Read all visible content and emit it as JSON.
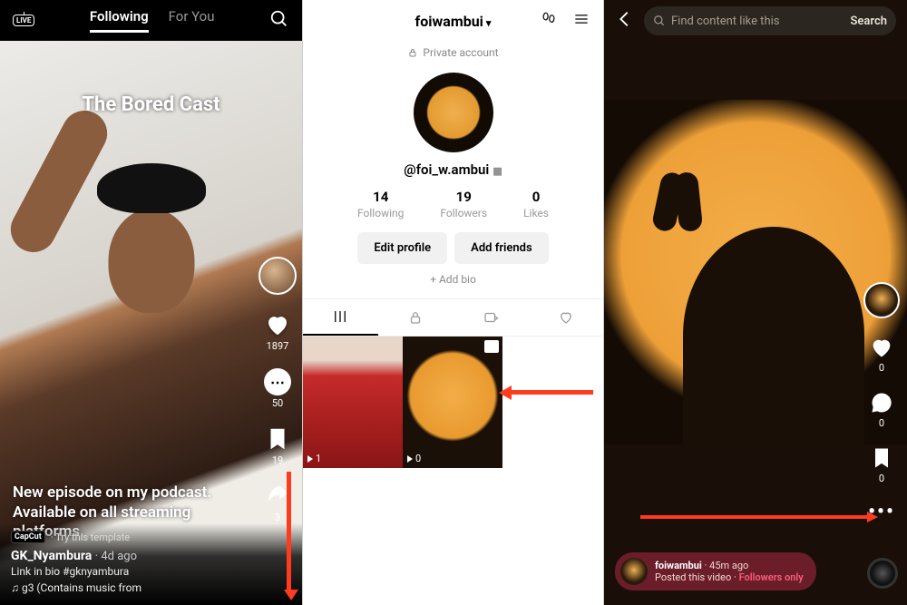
{
  "panel1": {
    "tabs": {
      "following": "Following",
      "foryou": "For You"
    },
    "cast_title": "The Bored Cast",
    "overlay_text": "New episode on my podcast. Available on all streaming platforms.",
    "capcut_badge": "CapCut",
    "template_label": "· Try this template",
    "author": "GK_Nyambura",
    "ago": "· 4d ago",
    "description": "Link in bio #gknyambura",
    "music": "♫ g3 (Contains music from",
    "counts": {
      "likes": "1897",
      "comments": "50",
      "saves": "19",
      "shares": "3"
    }
  },
  "panel2": {
    "username": "foiwambui",
    "private_label": "Private account",
    "handle": "@foi_w.ambui",
    "stats": {
      "following": {
        "num": "14",
        "label": "Following"
      },
      "followers": {
        "num": "19",
        "label": "Followers"
      },
      "likes": {
        "num": "0",
        "label": "Likes"
      }
    },
    "buttons": {
      "edit": "Edit profile",
      "add": "Add friends"
    },
    "add_bio": "+ Add bio",
    "thumbs": {
      "v1": "1",
      "v2": "0"
    }
  },
  "panel3": {
    "search_placeholder": "Find content like this",
    "search_button": "Search",
    "rail": {
      "likes": "0",
      "comments": "0",
      "saves": "0"
    },
    "noti": {
      "user": "foiwambui",
      "ago": "· 45m ago",
      "line": "Posted this video · ",
      "followers_only": "Followers only"
    }
  }
}
